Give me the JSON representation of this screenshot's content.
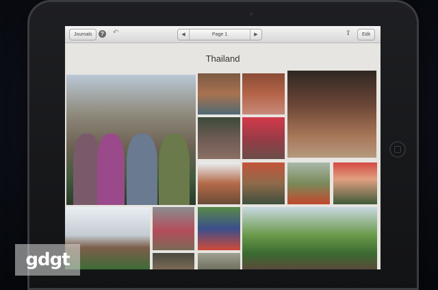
{
  "toolbar": {
    "journals_label": "Journals",
    "help_glyph": "?",
    "undo_glyph": "↶",
    "prev_glyph": "◀",
    "page_label": "Page 1",
    "next_glyph": "▶",
    "share_glyph": "⇪",
    "edit_label": "Edit"
  },
  "journal": {
    "title": "Thailand"
  },
  "icons": {
    "help": "help-icon",
    "undo": "undo-icon",
    "share": "share-icon",
    "prev": "chevron-left-icon",
    "next": "chevron-right-icon"
  },
  "watermark": {
    "text": "gdgt"
  }
}
